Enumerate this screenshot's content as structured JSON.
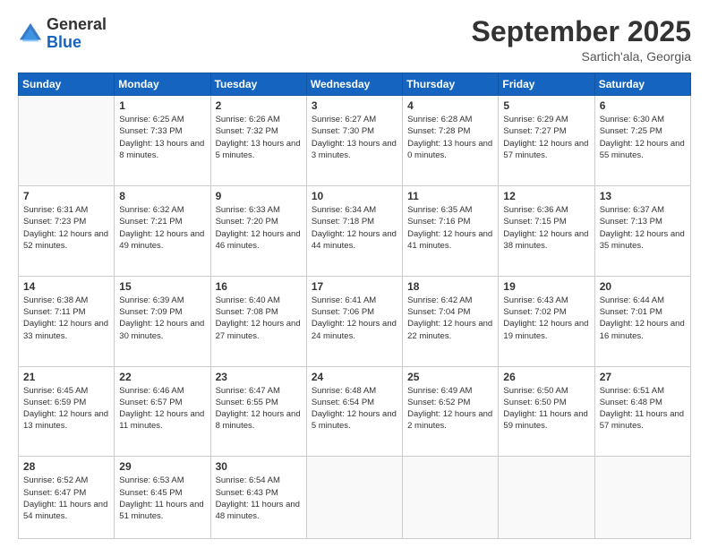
{
  "header": {
    "logo_general": "General",
    "logo_blue": "Blue",
    "month_title": "September 2025",
    "location": "Sartich'ala, Georgia"
  },
  "days_of_week": [
    "Sunday",
    "Monday",
    "Tuesday",
    "Wednesday",
    "Thursday",
    "Friday",
    "Saturday"
  ],
  "weeks": [
    [
      {
        "day": "",
        "sunrise": "",
        "sunset": "",
        "daylight": ""
      },
      {
        "day": "1",
        "sunrise": "Sunrise: 6:25 AM",
        "sunset": "Sunset: 7:33 PM",
        "daylight": "Daylight: 13 hours and 8 minutes."
      },
      {
        "day": "2",
        "sunrise": "Sunrise: 6:26 AM",
        "sunset": "Sunset: 7:32 PM",
        "daylight": "Daylight: 13 hours and 5 minutes."
      },
      {
        "day": "3",
        "sunrise": "Sunrise: 6:27 AM",
        "sunset": "Sunset: 7:30 PM",
        "daylight": "Daylight: 13 hours and 3 minutes."
      },
      {
        "day": "4",
        "sunrise": "Sunrise: 6:28 AM",
        "sunset": "Sunset: 7:28 PM",
        "daylight": "Daylight: 13 hours and 0 minutes."
      },
      {
        "day": "5",
        "sunrise": "Sunrise: 6:29 AM",
        "sunset": "Sunset: 7:27 PM",
        "daylight": "Daylight: 12 hours and 57 minutes."
      },
      {
        "day": "6",
        "sunrise": "Sunrise: 6:30 AM",
        "sunset": "Sunset: 7:25 PM",
        "daylight": "Daylight: 12 hours and 55 minutes."
      }
    ],
    [
      {
        "day": "7",
        "sunrise": "Sunrise: 6:31 AM",
        "sunset": "Sunset: 7:23 PM",
        "daylight": "Daylight: 12 hours and 52 minutes."
      },
      {
        "day": "8",
        "sunrise": "Sunrise: 6:32 AM",
        "sunset": "Sunset: 7:21 PM",
        "daylight": "Daylight: 12 hours and 49 minutes."
      },
      {
        "day": "9",
        "sunrise": "Sunrise: 6:33 AM",
        "sunset": "Sunset: 7:20 PM",
        "daylight": "Daylight: 12 hours and 46 minutes."
      },
      {
        "day": "10",
        "sunrise": "Sunrise: 6:34 AM",
        "sunset": "Sunset: 7:18 PM",
        "daylight": "Daylight: 12 hours and 44 minutes."
      },
      {
        "day": "11",
        "sunrise": "Sunrise: 6:35 AM",
        "sunset": "Sunset: 7:16 PM",
        "daylight": "Daylight: 12 hours and 41 minutes."
      },
      {
        "day": "12",
        "sunrise": "Sunrise: 6:36 AM",
        "sunset": "Sunset: 7:15 PM",
        "daylight": "Daylight: 12 hours and 38 minutes."
      },
      {
        "day": "13",
        "sunrise": "Sunrise: 6:37 AM",
        "sunset": "Sunset: 7:13 PM",
        "daylight": "Daylight: 12 hours and 35 minutes."
      }
    ],
    [
      {
        "day": "14",
        "sunrise": "Sunrise: 6:38 AM",
        "sunset": "Sunset: 7:11 PM",
        "daylight": "Daylight: 12 hours and 33 minutes."
      },
      {
        "day": "15",
        "sunrise": "Sunrise: 6:39 AM",
        "sunset": "Sunset: 7:09 PM",
        "daylight": "Daylight: 12 hours and 30 minutes."
      },
      {
        "day": "16",
        "sunrise": "Sunrise: 6:40 AM",
        "sunset": "Sunset: 7:08 PM",
        "daylight": "Daylight: 12 hours and 27 minutes."
      },
      {
        "day": "17",
        "sunrise": "Sunrise: 6:41 AM",
        "sunset": "Sunset: 7:06 PM",
        "daylight": "Daylight: 12 hours and 24 minutes."
      },
      {
        "day": "18",
        "sunrise": "Sunrise: 6:42 AM",
        "sunset": "Sunset: 7:04 PM",
        "daylight": "Daylight: 12 hours and 22 minutes."
      },
      {
        "day": "19",
        "sunrise": "Sunrise: 6:43 AM",
        "sunset": "Sunset: 7:02 PM",
        "daylight": "Daylight: 12 hours and 19 minutes."
      },
      {
        "day": "20",
        "sunrise": "Sunrise: 6:44 AM",
        "sunset": "Sunset: 7:01 PM",
        "daylight": "Daylight: 12 hours and 16 minutes."
      }
    ],
    [
      {
        "day": "21",
        "sunrise": "Sunrise: 6:45 AM",
        "sunset": "Sunset: 6:59 PM",
        "daylight": "Daylight: 12 hours and 13 minutes."
      },
      {
        "day": "22",
        "sunrise": "Sunrise: 6:46 AM",
        "sunset": "Sunset: 6:57 PM",
        "daylight": "Daylight: 12 hours and 11 minutes."
      },
      {
        "day": "23",
        "sunrise": "Sunrise: 6:47 AM",
        "sunset": "Sunset: 6:55 PM",
        "daylight": "Daylight: 12 hours and 8 minutes."
      },
      {
        "day": "24",
        "sunrise": "Sunrise: 6:48 AM",
        "sunset": "Sunset: 6:54 PM",
        "daylight": "Daylight: 12 hours and 5 minutes."
      },
      {
        "day": "25",
        "sunrise": "Sunrise: 6:49 AM",
        "sunset": "Sunset: 6:52 PM",
        "daylight": "Daylight: 12 hours and 2 minutes."
      },
      {
        "day": "26",
        "sunrise": "Sunrise: 6:50 AM",
        "sunset": "Sunset: 6:50 PM",
        "daylight": "Daylight: 11 hours and 59 minutes."
      },
      {
        "day": "27",
        "sunrise": "Sunrise: 6:51 AM",
        "sunset": "Sunset: 6:48 PM",
        "daylight": "Daylight: 11 hours and 57 minutes."
      }
    ],
    [
      {
        "day": "28",
        "sunrise": "Sunrise: 6:52 AM",
        "sunset": "Sunset: 6:47 PM",
        "daylight": "Daylight: 11 hours and 54 minutes."
      },
      {
        "day": "29",
        "sunrise": "Sunrise: 6:53 AM",
        "sunset": "Sunset: 6:45 PM",
        "daylight": "Daylight: 11 hours and 51 minutes."
      },
      {
        "day": "30",
        "sunrise": "Sunrise: 6:54 AM",
        "sunset": "Sunset: 6:43 PM",
        "daylight": "Daylight: 11 hours and 48 minutes."
      },
      {
        "day": "",
        "sunrise": "",
        "sunset": "",
        "daylight": ""
      },
      {
        "day": "",
        "sunrise": "",
        "sunset": "",
        "daylight": ""
      },
      {
        "day": "",
        "sunrise": "",
        "sunset": "",
        "daylight": ""
      },
      {
        "day": "",
        "sunrise": "",
        "sunset": "",
        "daylight": ""
      }
    ]
  ]
}
